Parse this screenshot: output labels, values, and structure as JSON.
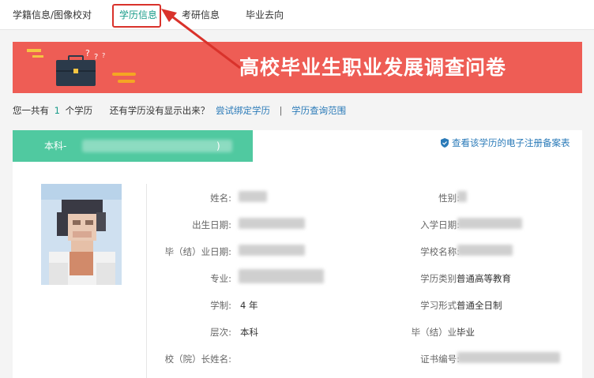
{
  "nav": {
    "tabs": [
      {
        "label": "学籍信息/图像校对"
      },
      {
        "label": "学历信息"
      },
      {
        "label": "考研信息"
      },
      {
        "label": "毕业去向"
      }
    ],
    "active_tab": "学历信息"
  },
  "banner": {
    "title": "高校毕业生职业发展调查问卷"
  },
  "summary": {
    "count_prefix": "您一共有",
    "count": "1",
    "count_suffix": "个学历",
    "question": "还有学历没有显示出来？",
    "bind_link": "尝试绑定学历",
    "separator": "|",
    "scope_link": "学历查询范围"
  },
  "record": {
    "degree_tab_label": "本科-",
    "degree_tab_suffix": ")",
    "filing_link": "查看该学历的电子注册备案表",
    "fields": {
      "name_label": "姓名:",
      "gender_label": "性别:",
      "birth_label": "出生日期:",
      "enroll_label": "入学日期:",
      "grad_label": "毕（结）业日期:",
      "school_label": "学校名称:",
      "major_label": "专业:",
      "category_label": "学历类别:",
      "category_value": "普通高等教育",
      "duration_label": "学制:",
      "duration_value": "4 年",
      "study_form_label": "学习形式:",
      "study_form_value": "普通全日制",
      "level_label": "层次:",
      "level_value": "本科",
      "completion_label": "毕（结）业:",
      "completion_value": "毕业",
      "president_label": "校（院）长姓名:",
      "cert_label": "证书编号:"
    }
  },
  "colors": {
    "accent_green": "#1a9c8a",
    "banner_red": "#ee5d55",
    "degree_tab": "#50c9a0",
    "link_blue": "#2a7ab8",
    "highlight_red": "#d9322b"
  }
}
